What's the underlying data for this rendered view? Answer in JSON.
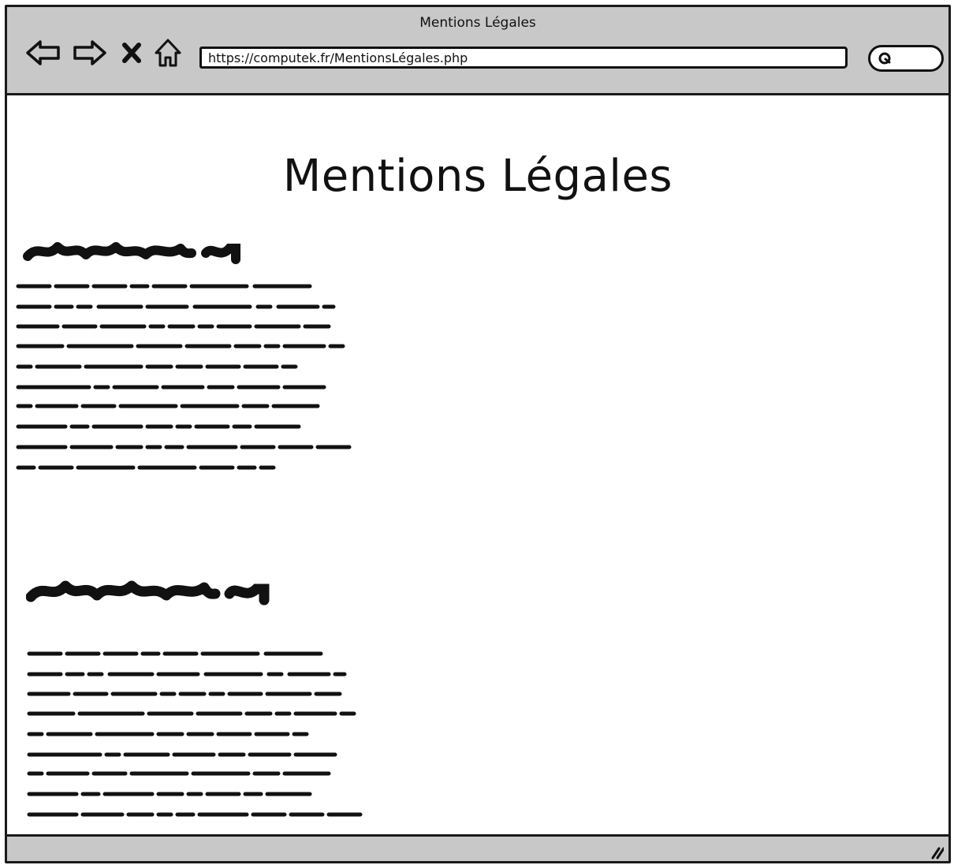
{
  "window": {
    "title": "Mentions Légales"
  },
  "toolbar": {
    "back_icon": "back-arrow-icon",
    "forward_icon": "forward-arrow-icon",
    "stop_icon": "close-icon",
    "home_icon": "home-icon",
    "search_icon": "search-icon"
  },
  "address_bar": {
    "url": "https://computek.fr/MentionsLégales.php"
  },
  "page": {
    "title": "Mentions Légales"
  },
  "colors": {
    "chrome": "#c8c8c8",
    "ink": "#111111",
    "background": "#ffffff"
  }
}
